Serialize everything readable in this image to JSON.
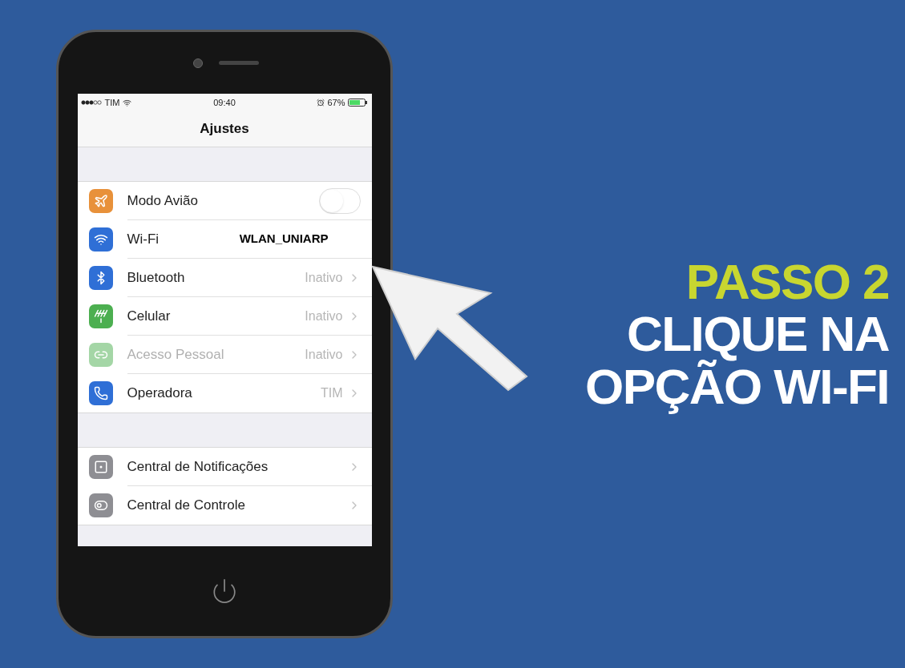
{
  "status_bar": {
    "carrier": "TIM",
    "time": "09:40",
    "battery": "67%"
  },
  "nav": {
    "title": "Ajustes"
  },
  "groups": [
    {
      "rows": [
        {
          "kind": "toggle",
          "label": "Modo Avião",
          "on": false,
          "disabled": false
        },
        {
          "kind": "network",
          "label": "Wi-Fi",
          "value": "WLAN_UNIARP",
          "disabled": false
        },
        {
          "kind": "link",
          "label": "Bluetooth",
          "value": "Inativo",
          "disabled": false
        },
        {
          "kind": "link",
          "label": "Celular",
          "value": "Inativo",
          "disabled": false
        },
        {
          "kind": "link",
          "label": "Acesso Pessoal",
          "value": "Inativo",
          "disabled": true
        },
        {
          "kind": "link",
          "label": "Operadora",
          "value": "TIM",
          "disabled": false
        }
      ]
    },
    {
      "rows": [
        {
          "kind": "link",
          "label": "Central de Notificações",
          "disabled": false
        },
        {
          "kind": "link",
          "label": "Central de Controle",
          "disabled": false
        }
      ]
    }
  ],
  "headline": {
    "step": "PASSO 2",
    "lines": [
      "CLIQUE NA",
      "OPÇÃO WI-FI"
    ]
  }
}
